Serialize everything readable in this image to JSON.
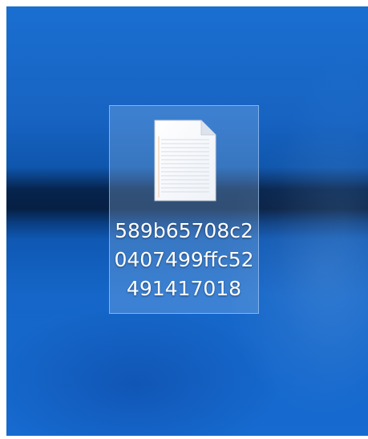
{
  "desktop": {
    "background_color": "#1566c8",
    "stripe_color": "#061f44"
  },
  "file": {
    "icon": "text-document-icon",
    "name_lines": [
      "589b65708c2",
      "0407499ffc52",
      "491417018"
    ],
    "selected": true
  }
}
